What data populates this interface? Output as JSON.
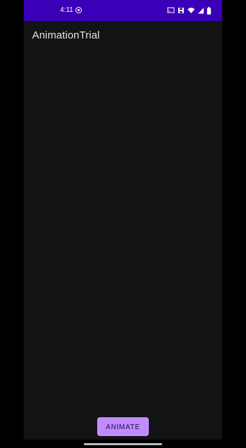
{
  "status_bar": {
    "time": "4:11",
    "background_color": "#3a00b8",
    "icons": [
      "cast-icon",
      "save-icon",
      "wifi-icon",
      "signal-icon",
      "battery-icon"
    ]
  },
  "app": {
    "title": "AnimationTrial",
    "background_color": "#111413"
  },
  "animate_button": {
    "label": "ANIMATE",
    "color": "#c08bff"
  }
}
